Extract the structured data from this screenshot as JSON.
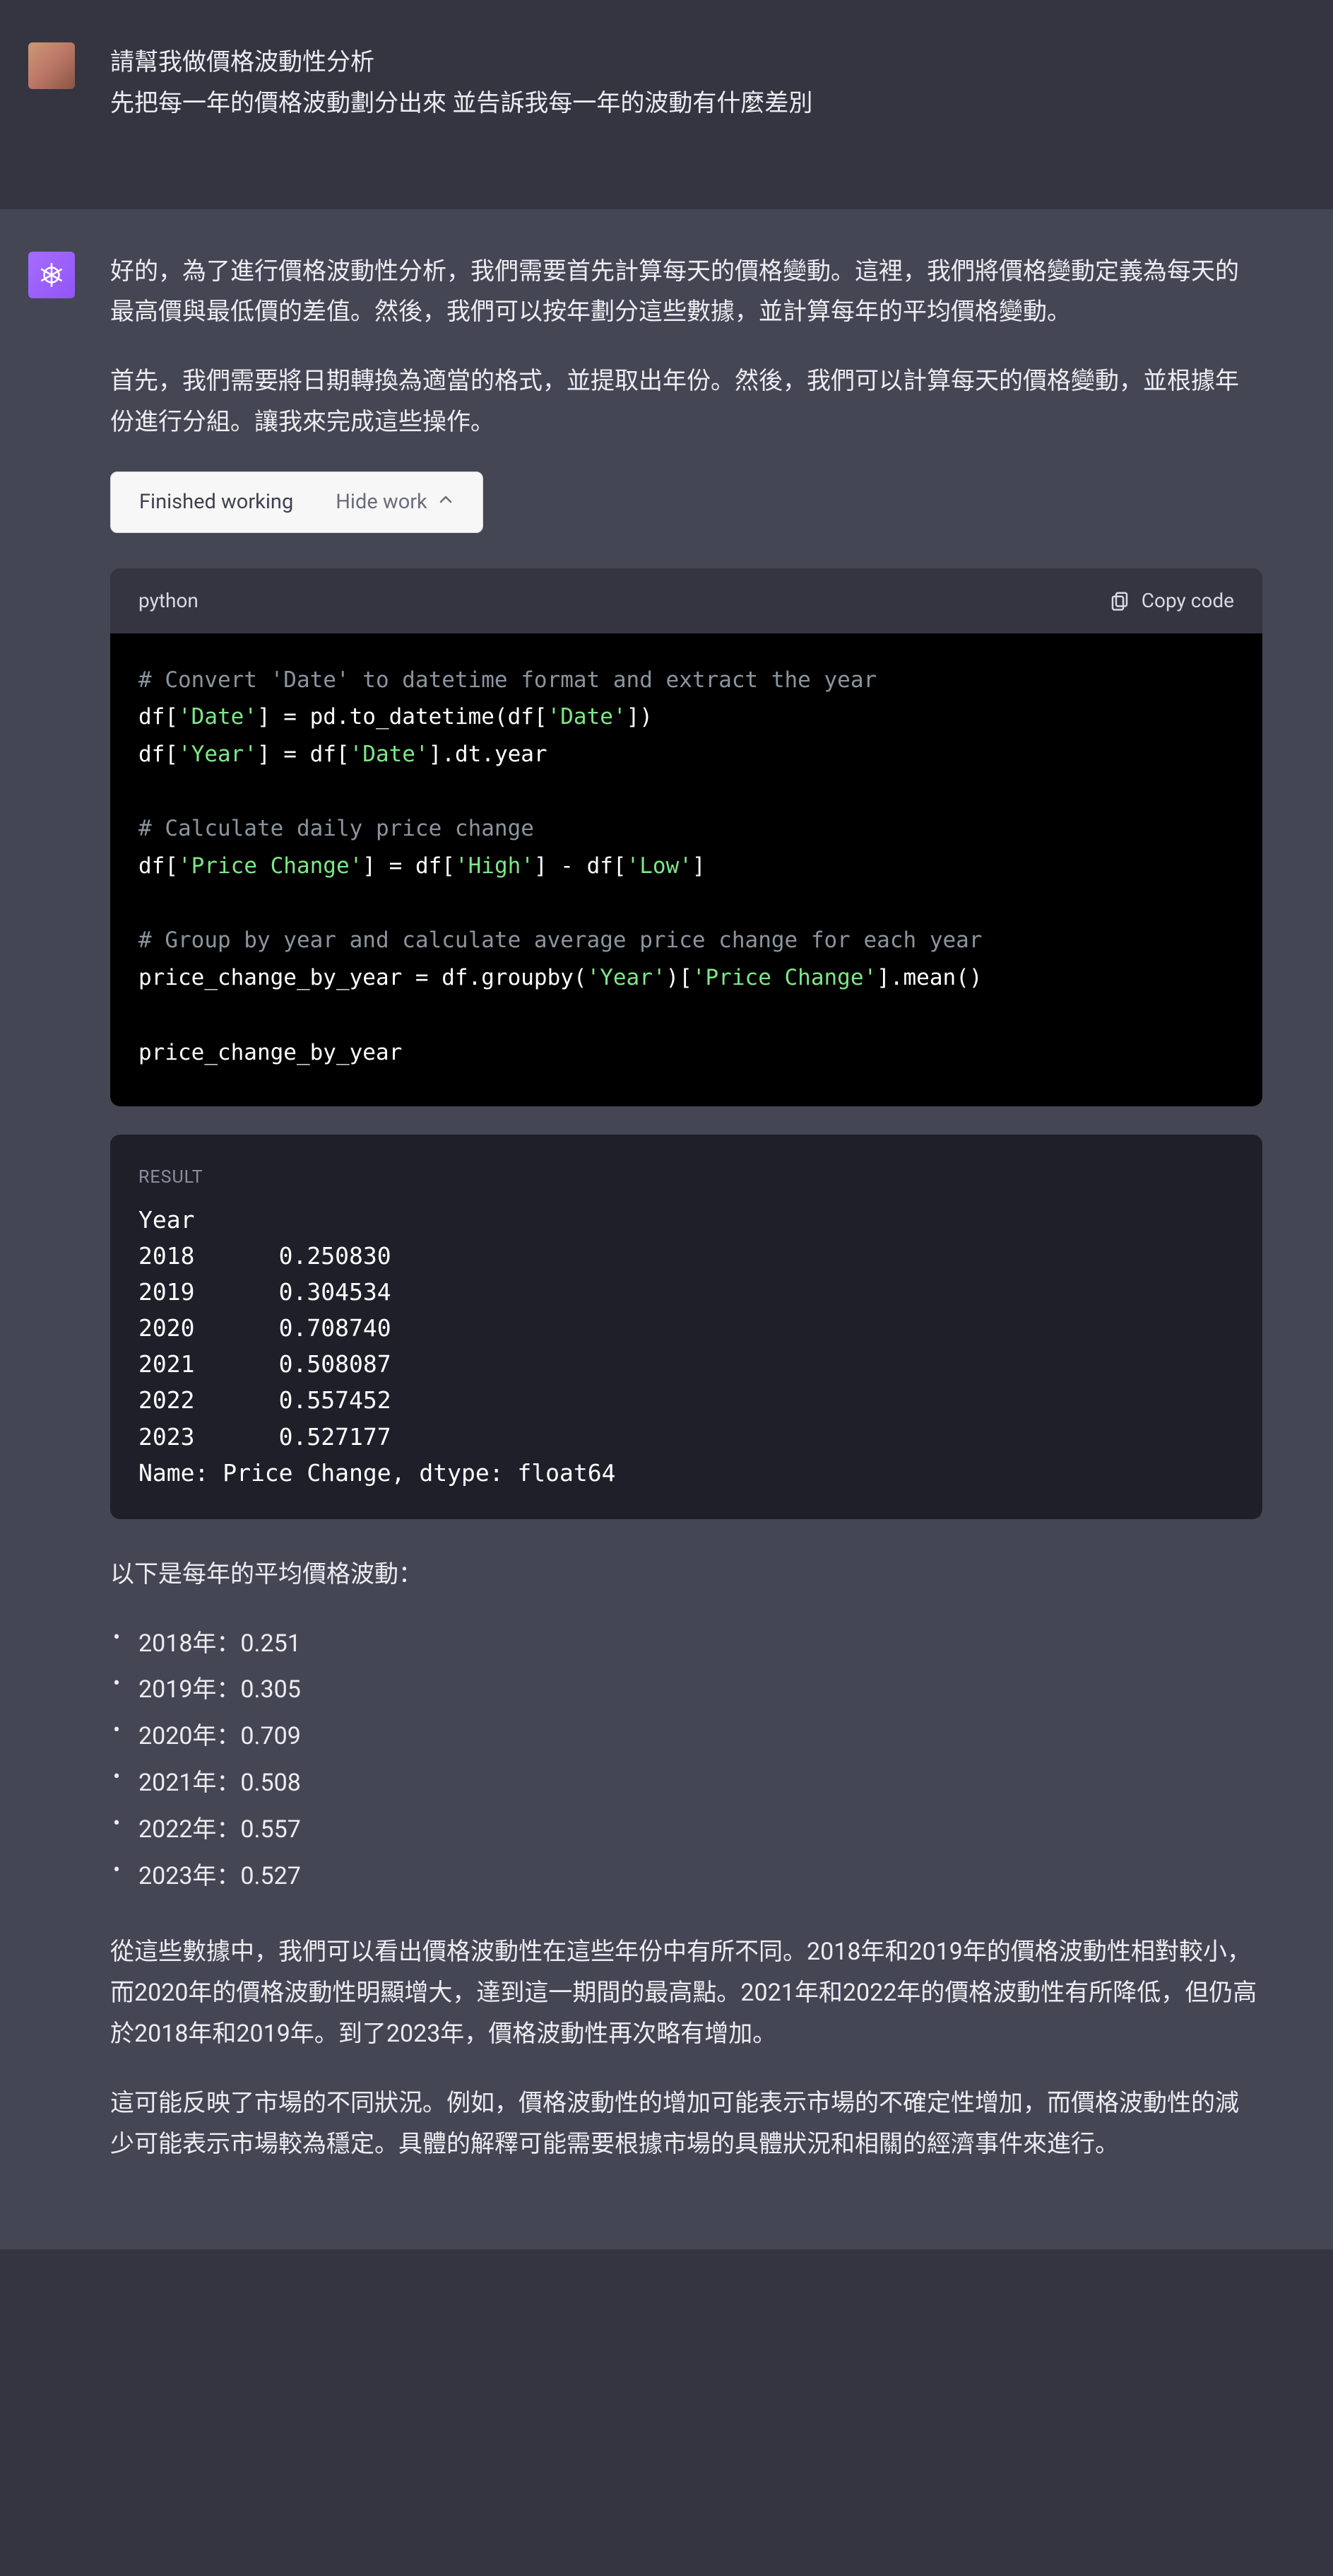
{
  "user": {
    "line1": "請幫我做價格波動性分析",
    "line2": "先把每一年的價格波動劃分出來 並告訴我每一年的波動有什麼差別"
  },
  "assistant": {
    "intro1": "好的，為了進行價格波動性分析，我們需要首先計算每天的價格變動。這裡，我們將價格變動定義為每天的最高價與最低價的差值。然後，我們可以按年劃分這些數據，並計算每年的平均價格變動。",
    "intro2": "首先，我們需要將日期轉換為適當的格式，並提取出年份。然後，我們可以計算每天的價格變動，並根據年份進行分組。讓我來完成這些操作。",
    "toggle": {
      "status": "Finished working",
      "action": "Hide work"
    },
    "code": {
      "lang": "python",
      "copy": "Copy code",
      "c1": "# Convert 'Date' to datetime format and extract the year",
      "l1a": "df[",
      "l1b": "'Date'",
      "l1c": "] = pd.to_datetime(df[",
      "l1d": "'Date'",
      "l1e": "])",
      "l2a": "df[",
      "l2b": "'Year'",
      "l2c": "] = df[",
      "l2d": "'Date'",
      "l2e": "].dt.year",
      "c2": "# Calculate daily price change",
      "l3a": "df[",
      "l3b": "'Price Change'",
      "l3c": "] = df[",
      "l3d": "'High'",
      "l3e": "] - df[",
      "l3f": "'Low'",
      "l3g": "]",
      "c3": "# Group by year and calculate average price change for each year",
      "l4a": "price_change_by_year = df.groupby(",
      "l4b": "'Year'",
      "l4c": ")[",
      "l4d": "'Price Change'",
      "l4e": "].mean()",
      "l5": "price_change_by_year"
    },
    "result": {
      "label": "RESULT",
      "header": "Year",
      "rows": [
        {
          "year": "2018",
          "val": "0.250830"
        },
        {
          "year": "2019",
          "val": "0.304534"
        },
        {
          "year": "2020",
          "val": "0.708740"
        },
        {
          "year": "2021",
          "val": "0.508087"
        },
        {
          "year": "2022",
          "val": "0.557452"
        },
        {
          "year": "2023",
          "val": "0.527177"
        }
      ],
      "footer": "Name: Price Change, dtype: float64"
    },
    "summary_intro": "以下是每年的平均價格波動：",
    "summary": [
      "2018年：0.251",
      "2019年：0.305",
      "2020年：0.709",
      "2021年：0.508",
      "2022年：0.557",
      "2023年：0.527"
    ],
    "para1": "從這些數據中，我們可以看出價格波動性在這些年份中有所不同。2018年和2019年的價格波動性相對較小，而2020年的價格波動性明顯增大，達到這一期間的最高點。2021年和2022年的價格波動性有所降低，但仍高於2018年和2019年。到了2023年，價格波動性再次略有增加。",
    "para2": "這可能反映了市場的不同狀況。例如，價格波動性的增加可能表示市場的不確定性增加，而價格波動性的減少可能表示市場較為穩定。具體的解釋可能需要根據市場的具體狀況和相關的經濟事件來進行。"
  }
}
